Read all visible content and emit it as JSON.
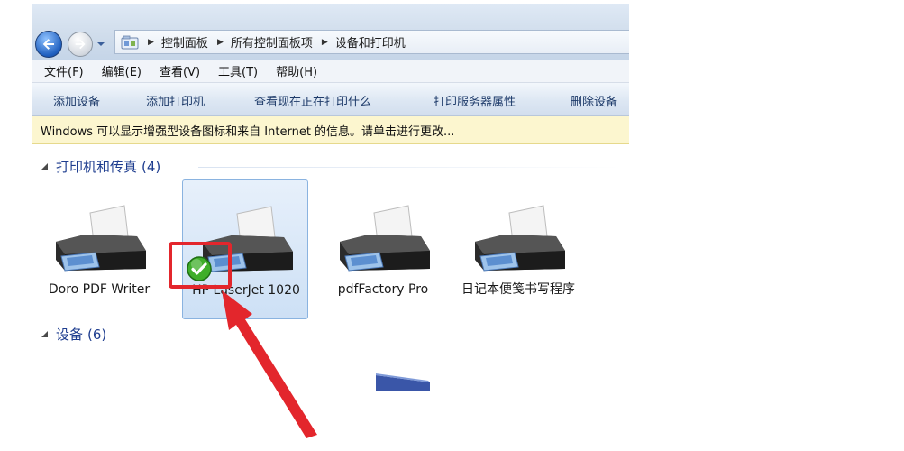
{
  "breadcrumbs": [
    "控制面板",
    "所有控制面板项",
    "设备和打印机"
  ],
  "menu": [
    "文件(F)",
    "编辑(E)",
    "查看(V)",
    "工具(T)",
    "帮助(H)"
  ],
  "toolbar": {
    "add_device": "添加设备",
    "add_printer": "添加打印机",
    "see_printing": "查看现在正在打印什么",
    "print_server_properties": "打印服务器属性",
    "remove_device": "删除设备"
  },
  "info_bar": "Windows 可以显示增强型设备图标和来自 Internet 的信息。请单击进行更改...",
  "groups": {
    "printers": {
      "title": "打印机和传真",
      "count": "(4)"
    },
    "devices": {
      "title": "设备",
      "count": "(6)"
    }
  },
  "printers": [
    {
      "label": "Doro PDF Writer",
      "default": false,
      "selected": false
    },
    {
      "label": "HP LaserJet 1020",
      "default": true,
      "selected": true
    },
    {
      "label": "pdfFactory Pro",
      "default": false,
      "selected": false
    },
    {
      "label": "日记本便笺书写程序",
      "default": false,
      "selected": false
    }
  ],
  "icons": {
    "back": "arrow-left-icon",
    "forward": "arrow-right-icon",
    "location": "control-panel-icon",
    "default_printer": "check-icon"
  },
  "colors": {
    "annotation": "#e3262c",
    "group_header": "#1e3d8f",
    "info_bar_bg": "#fcf6cf"
  }
}
